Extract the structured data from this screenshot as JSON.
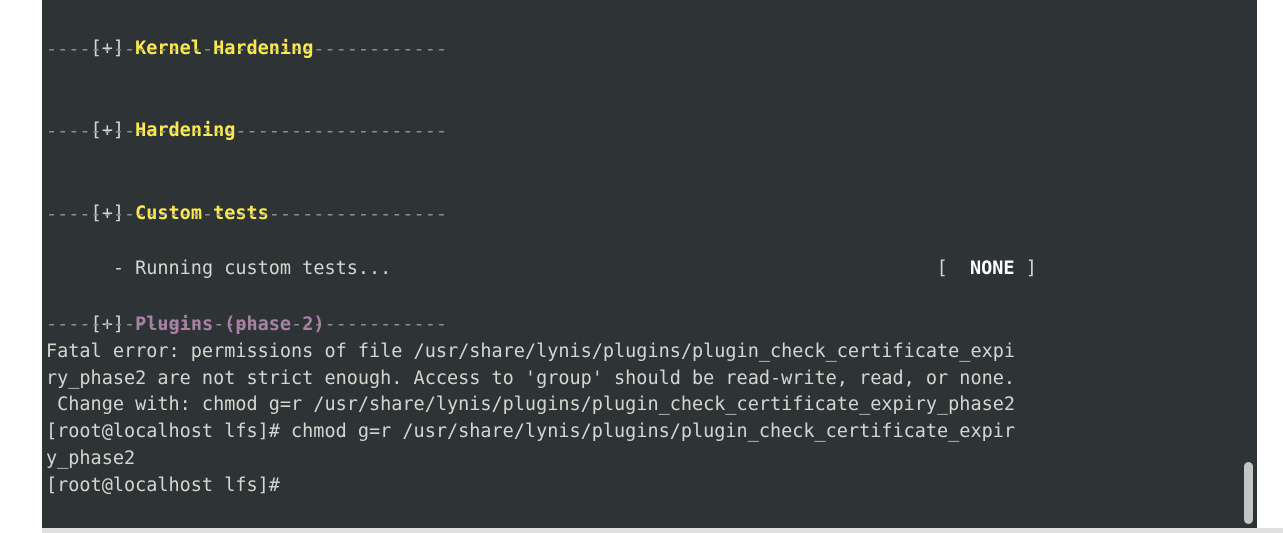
{
  "terminal": {
    "sections": [
      {
        "marker": "[+]",
        "title": "Kernel Hardening"
      },
      {
        "marker": "[+]",
        "title": "Hardening"
      },
      {
        "marker": "[+]",
        "title": "Custom tests"
      },
      {
        "marker": "[+]",
        "title": "Plugins (phase 2)"
      }
    ],
    "separator": "------------------------------------",
    "custom_test": {
      "text": "  - Running custom tests...",
      "status_open": "[",
      "status": "NONE",
      "status_close": "]"
    },
    "output_lines": [
      "Fatal error: permissions of file /usr/share/lynis/plugins/plugin_check_certificate_expi",
      "ry_phase2 are not strict enough. Access to 'group' should be read-write, read, or none.",
      " Change with: chmod g=r /usr/share/lynis/plugins/plugin_check_certificate_expiry_phase2",
      "[root@localhost lfs]# chmod g=r /usr/share/lynis/plugins/plugin_check_certificate_expir",
      "y_phase2",
      "[root@localhost lfs]# "
    ]
  }
}
